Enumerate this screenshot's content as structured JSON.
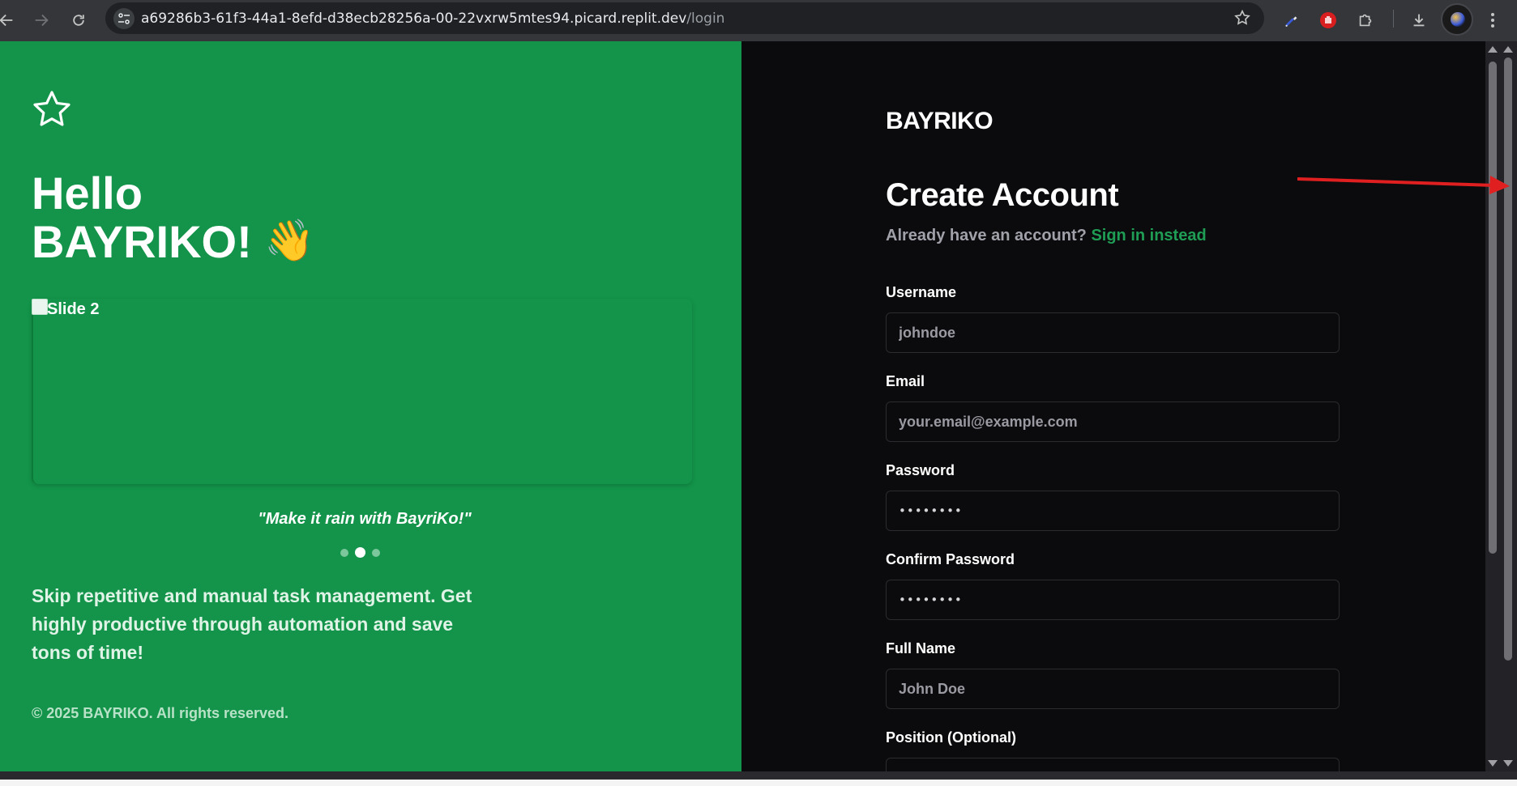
{
  "browser": {
    "url_host": "a69286b3-61f3-44a1-8efd-d38ecb28256a-00-22vxrw5mtes94.picard.replit.dev",
    "url_path": "/login",
    "icons": [
      "back-icon",
      "forward-icon",
      "reload-icon",
      "site-info-icon",
      "bookmark-star-icon",
      "eyedropper-icon",
      "extension-stop-icon",
      "extensions-puzzle-icon",
      "download-icon",
      "profile-avatar",
      "menu-dots-icon"
    ]
  },
  "hero": {
    "greeting_line1": "Hello",
    "greeting_line2": "BAYRIKO!",
    "wave_emoji": "👋",
    "slide_alt": "Slide 2",
    "quote": "\"Make it rain with BayriKo!\"",
    "carousel": {
      "total": 3,
      "active_index": 1
    },
    "tagline": "Skip repetitive and manual task management. Get highly productive through automation and save tons of time!",
    "copyright": "© 2025 BAYRIKO. All rights reserved."
  },
  "form": {
    "brand": "BAYRIKO",
    "title": "Create Account",
    "subtitle": "Already have an account?",
    "signin_link": "Sign in instead",
    "fields": [
      {
        "label": "Username",
        "placeholder": "johndoe"
      },
      {
        "label": "Email",
        "placeholder": "your.email@example.com"
      },
      {
        "label": "Password",
        "placeholder": "••••••••"
      },
      {
        "label": "Confirm Password",
        "placeholder": "••••••••"
      },
      {
        "label": "Full Name",
        "placeholder": "John Doe"
      },
      {
        "label": "Position (Optional)",
        "placeholder": ""
      }
    ]
  },
  "colors": {
    "left_panel": "#13944a",
    "right_panel": "#0b0b0d",
    "link_green": "#1f9d55",
    "annotation_arrow": "#e02020"
  }
}
